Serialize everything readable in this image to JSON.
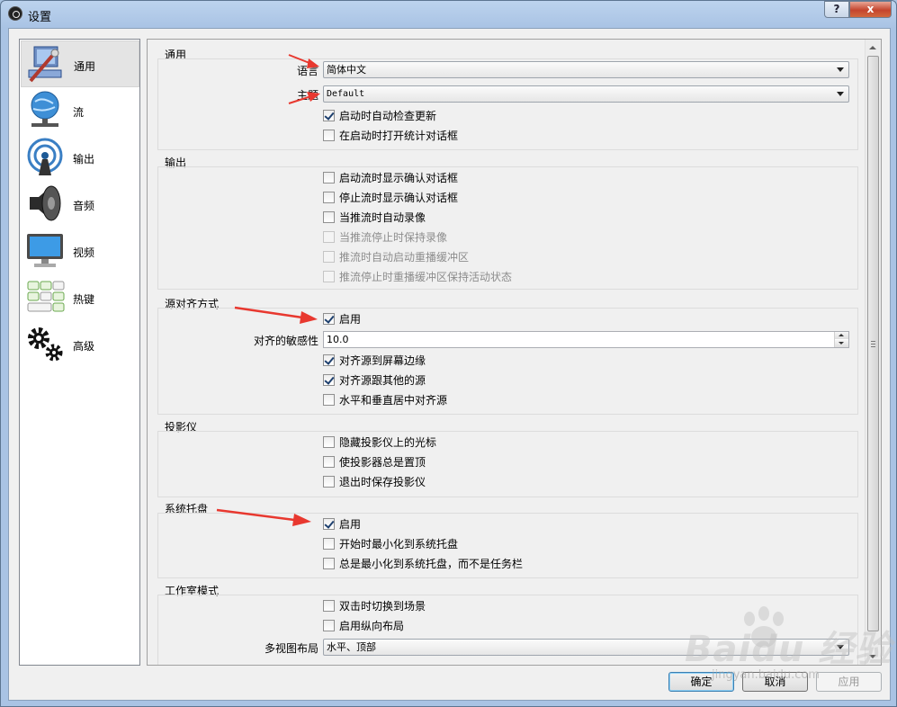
{
  "window": {
    "title": "设置",
    "help_label": "?",
    "close_label": "x"
  },
  "sidebar": {
    "items": [
      {
        "label": "通用",
        "icon": "general-icon",
        "selected": true
      },
      {
        "label": "流",
        "icon": "stream-icon"
      },
      {
        "label": "输出",
        "icon": "output-icon"
      },
      {
        "label": "音频",
        "icon": "audio-icon"
      },
      {
        "label": "视频",
        "icon": "video-icon"
      },
      {
        "label": "热键",
        "icon": "hotkeys-icon"
      },
      {
        "label": "高级",
        "icon": "advanced-icon"
      }
    ]
  },
  "general": {
    "title": "通用",
    "language_label": "语言",
    "language_value": "简体中文",
    "theme_label": "主题",
    "theme_value": "Default",
    "check_updates": {
      "label": "启动时自动检查更新",
      "checked": true
    },
    "open_stats": {
      "label": "在启动时打开统计对话框",
      "checked": false
    }
  },
  "output": {
    "title": "输出",
    "items": [
      {
        "label": "启动流时显示确认对话框",
        "checked": false,
        "enabled": true
      },
      {
        "label": "停止流时显示确认对话框",
        "checked": false,
        "enabled": true
      },
      {
        "label": "当推流时自动录像",
        "checked": false,
        "enabled": true
      },
      {
        "label": "当推流停止时保持录像",
        "checked": false,
        "enabled": false
      },
      {
        "label": "推流时自动启动重播缓冲区",
        "checked": false,
        "enabled": false
      },
      {
        "label": "推流停止时重播缓冲区保持活动状态",
        "checked": false,
        "enabled": false
      }
    ]
  },
  "snapping": {
    "title": "源对齐方式",
    "enable": {
      "label": "启用",
      "checked": true
    },
    "sensitivity_label": "对齐的敏感性",
    "sensitivity_value": "10.0",
    "screen_edges": {
      "label": "对齐源到屏幕边缘",
      "checked": true
    },
    "other_sources": {
      "label": "对齐源跟其他的源",
      "checked": true
    },
    "center": {
      "label": "水平和垂直居中对齐源",
      "checked": false
    }
  },
  "projectors": {
    "title": "投影仪",
    "items": [
      {
        "label": "隐藏投影仪上的光标",
        "checked": false
      },
      {
        "label": "使投影器总是置顶",
        "checked": false
      },
      {
        "label": "退出时保存投影仪",
        "checked": false
      }
    ]
  },
  "tray": {
    "title": "系统托盘",
    "items": [
      {
        "label": "启用",
        "checked": true
      },
      {
        "label": "开始时最小化到系统托盘",
        "checked": false
      },
      {
        "label": "总是最小化到系统托盘，而不是任务栏",
        "checked": false
      }
    ]
  },
  "studio": {
    "title": "工作室模式",
    "items": [
      {
        "label": "双击时切换到场景",
        "checked": false
      },
      {
        "label": "启用纵向布局",
        "checked": false
      }
    ],
    "multiview_label": "多视图布局",
    "multiview_value": "水平、顶部"
  },
  "buttons": {
    "ok": "确定",
    "cancel": "取消",
    "apply": "应用"
  },
  "watermark": {
    "logo": "Baidu 经验",
    "url": "jingyan.baidu.com"
  },
  "colors": {
    "annotation_arrow": "#e8382f",
    "accent": "#3c7fb1"
  }
}
